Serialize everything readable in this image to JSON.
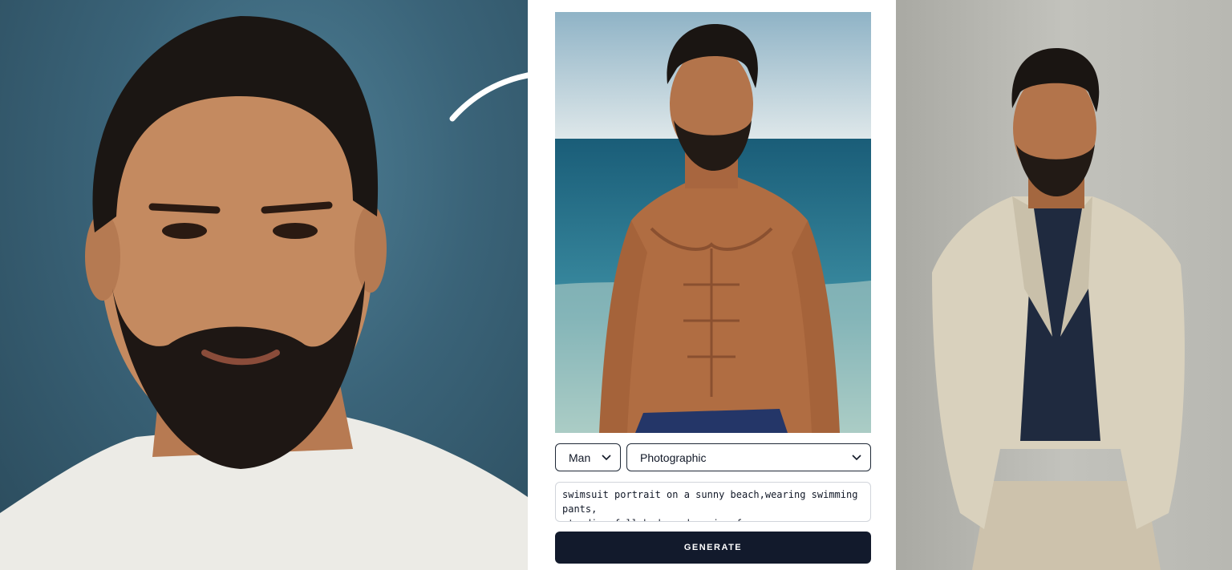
{
  "gender_select": {
    "value": "Man"
  },
  "style_select": {
    "value": "Photographic"
  },
  "prompt": {
    "text": "swimsuit portrait on a sunny beach,wearing swimming pants,\nstanding full body and posing for camera"
  },
  "generate_button": {
    "label": "GENERATE"
  },
  "icons": {
    "dropdown": "chevron-down-icon",
    "arrow": "curved-arrow-icon"
  },
  "colors": {
    "button_bg": "#121a2c",
    "button_text": "#ffffff",
    "select_border": "#1f2937"
  }
}
